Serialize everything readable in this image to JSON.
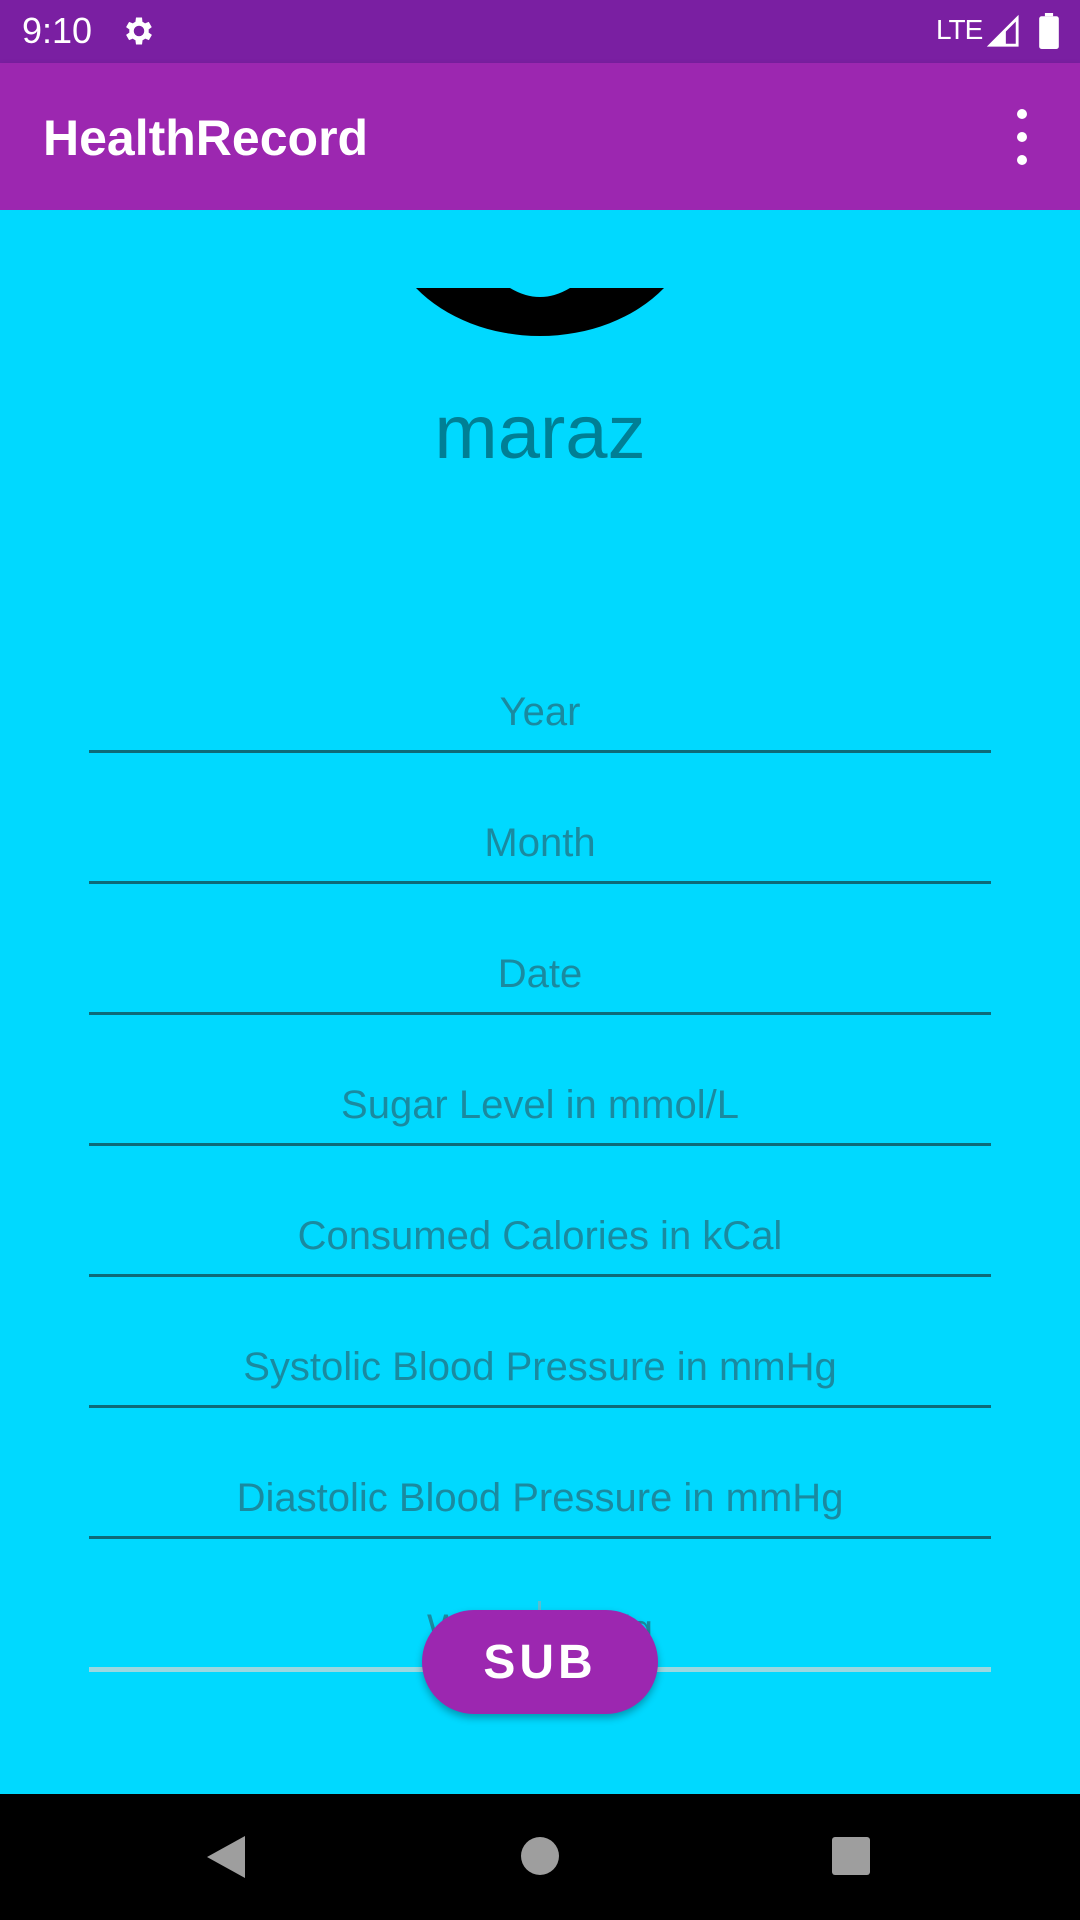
{
  "status_bar": {
    "time": "9:10",
    "network": "LTE",
    "icons": [
      "gear-icon",
      "signal-icon",
      "battery-icon"
    ]
  },
  "app_bar": {
    "title": "HealthRecord",
    "menu_icon": "overflow-menu-icon"
  },
  "profile": {
    "username": "maraz"
  },
  "form": {
    "fields": [
      {
        "placeholder": "Year",
        "value": ""
      },
      {
        "placeholder": "Month",
        "value": ""
      },
      {
        "placeholder": "Date",
        "value": ""
      },
      {
        "placeholder": "Sugar Level in mmol/L",
        "value": ""
      },
      {
        "placeholder": "Consumed Calories in kCal",
        "value": ""
      },
      {
        "placeholder": "Systolic Blood Pressure in mmHg",
        "value": ""
      },
      {
        "placeholder": "Diastolic Blood Pressure in mmHg",
        "value": ""
      },
      {
        "placeholder": "Weight in Kg",
        "value": ""
      }
    ],
    "submit_label": "SUB"
  },
  "nav_bar": {
    "icons": [
      "back-icon",
      "home-icon",
      "recents-icon"
    ]
  },
  "colors": {
    "status_bar": "#7a1fa2",
    "app_bar": "#9c27b0",
    "background": "#00d9ff",
    "button": "#9c27b0",
    "text_teal": "#007f95"
  }
}
